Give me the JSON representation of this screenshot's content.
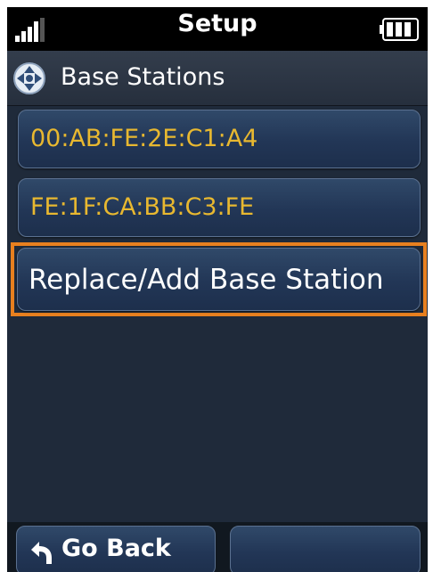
{
  "status_bar": {
    "title": "Setup",
    "signal_icon": "signal-bars-icon",
    "battery_icon": "battery-icon"
  },
  "header": {
    "title": "Base Stations",
    "icon": "base-station-icon"
  },
  "list": {
    "items": [
      {
        "label": "00:AB:FE:2E:C1:A4"
      },
      {
        "label": "FE:1F:CA:BB:C3:FE"
      }
    ],
    "action_label": "Replace/Add Base Station"
  },
  "softkeys": {
    "left_label": "Go Back",
    "left_icon": "back-arrow-icon",
    "right_label": ""
  },
  "colors": {
    "accent": "#e8801f",
    "mac_text": "#e8b830",
    "background": "#1f2a3a"
  }
}
